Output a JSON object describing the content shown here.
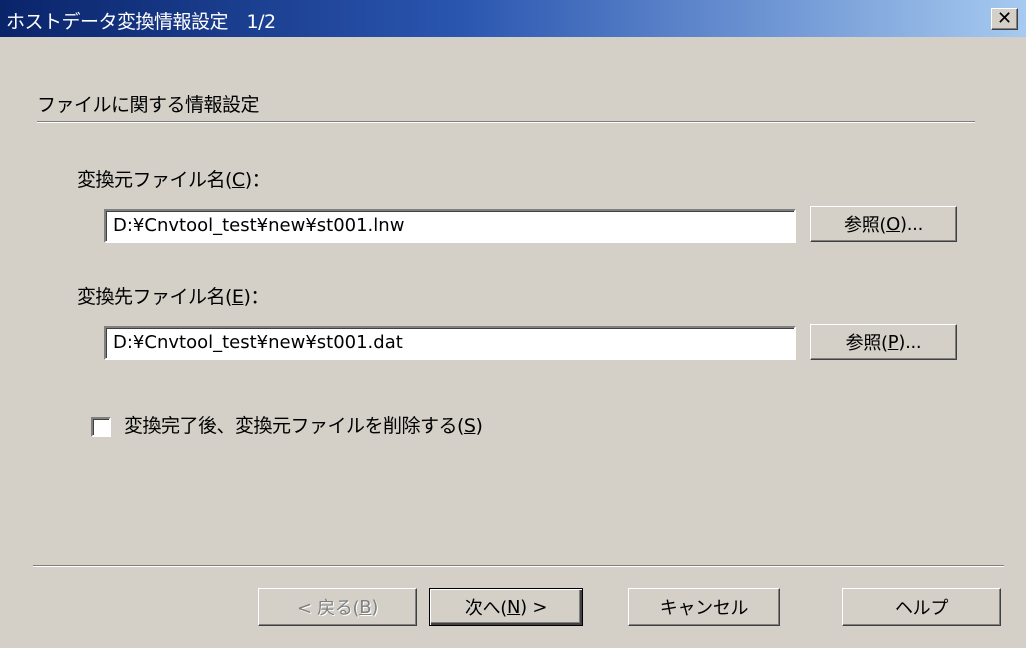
{
  "window": {
    "title": "ホストデータ変換情報設定　1/2",
    "close_glyph": "✕"
  },
  "section": {
    "heading": "ファイルに関する情報設定"
  },
  "source": {
    "label_prefix": "変換元ファイル名(",
    "label_accel": "C",
    "label_suffix": ")：",
    "value": "D:¥Cnvtool_test¥new¥st001.lnw",
    "browse_prefix": "参照(",
    "browse_accel": "O",
    "browse_suffix": ")..."
  },
  "destination": {
    "label_prefix": "変換先ファイル名(",
    "label_accel": "E",
    "label_suffix": ")：",
    "value": "D:¥Cnvtool_test¥new¥st001.dat",
    "browse_prefix": "参照(",
    "browse_accel": "P",
    "browse_suffix": ")..."
  },
  "delete_option": {
    "checked": false,
    "label_prefix": "変換完了後、変換元ファイルを削除する(",
    "label_accel": "S",
    "label_suffix": ")"
  },
  "buttons": {
    "back_prefix": "< 戻る(",
    "back_accel": "B",
    "back_suffix": ")",
    "next_prefix": "次へ(",
    "next_accel": "N",
    "next_suffix": ") >",
    "cancel": "キャンセル",
    "help": "ヘルプ"
  }
}
